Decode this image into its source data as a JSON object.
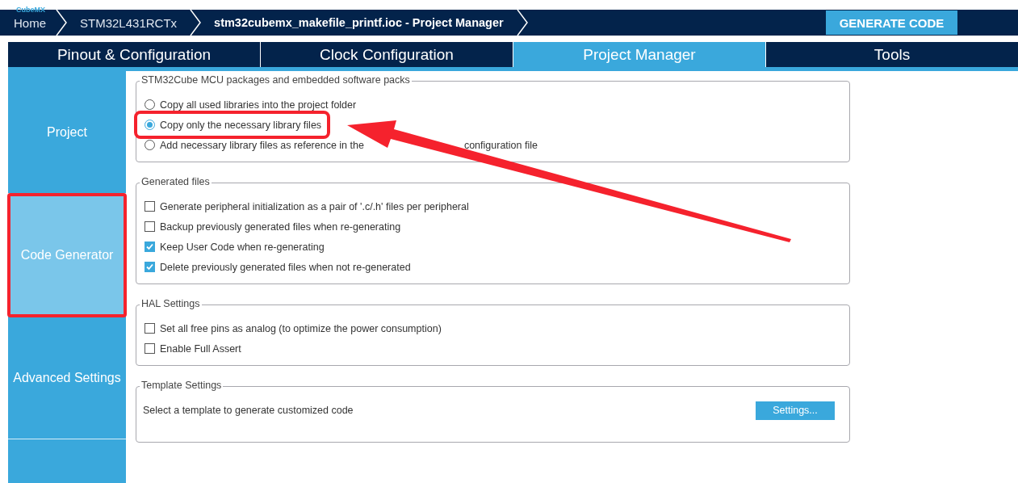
{
  "logo": "CubeMX",
  "breadcrumbs": [
    {
      "label": "Home",
      "current": false
    },
    {
      "label": "STM32L431RCTx",
      "current": false
    },
    {
      "label": "stm32cubemx_makefile_printf.ioc - Project Manager",
      "current": true
    }
  ],
  "generate_button": "GENERATE CODE",
  "tabs": [
    {
      "label": "Pinout & Configuration",
      "selected": false
    },
    {
      "label": "Clock Configuration",
      "selected": false
    },
    {
      "label": "Project Manager",
      "selected": true
    },
    {
      "label": "Tools",
      "selected": false
    }
  ],
  "sidebar": {
    "items": [
      {
        "label": "Project",
        "selected": false,
        "highlighted": false
      },
      {
        "label": "Code Generator",
        "selected": true,
        "highlighted": true
      },
      {
        "label": "Advanced Settings",
        "selected": false,
        "highlighted": false
      }
    ]
  },
  "sections": [
    {
      "title": "STM32Cube MCU packages and embedded software packs",
      "options": [
        {
          "kind": "radio",
          "label": "Copy all used libraries into the project folder",
          "selected": false,
          "highlighted": false
        },
        {
          "kind": "radio",
          "label": "Copy only the necessary library files",
          "selected": true,
          "highlighted": true
        },
        {
          "kind": "radio",
          "label_parts": [
            "Add necessary library files as reference in the",
            "configuration file"
          ],
          "selected": false,
          "highlighted": false
        }
      ]
    },
    {
      "title": "Generated files",
      "options": [
        {
          "kind": "checkbox",
          "label": "Generate peripheral initialization as a pair of '.c/.h' files per peripheral",
          "checked": false
        },
        {
          "kind": "checkbox",
          "label": "Backup previously generated files when re-generating",
          "checked": false
        },
        {
          "kind": "checkbox",
          "label": "Keep User Code when re-generating",
          "checked": true
        },
        {
          "kind": "checkbox",
          "label": "Delete previously generated files when not re-generated",
          "checked": true
        }
      ]
    },
    {
      "title": "HAL Settings",
      "options": [
        {
          "kind": "checkbox",
          "label": "Set all free pins as analog (to optimize the power consumption)",
          "checked": false
        },
        {
          "kind": "checkbox",
          "label": "Enable Full Assert",
          "checked": false
        }
      ]
    },
    {
      "title": "Template Settings",
      "options": [
        {
          "kind": "action",
          "label": "Select a template to generate customized code",
          "button": "Settings..."
        }
      ]
    }
  ]
}
